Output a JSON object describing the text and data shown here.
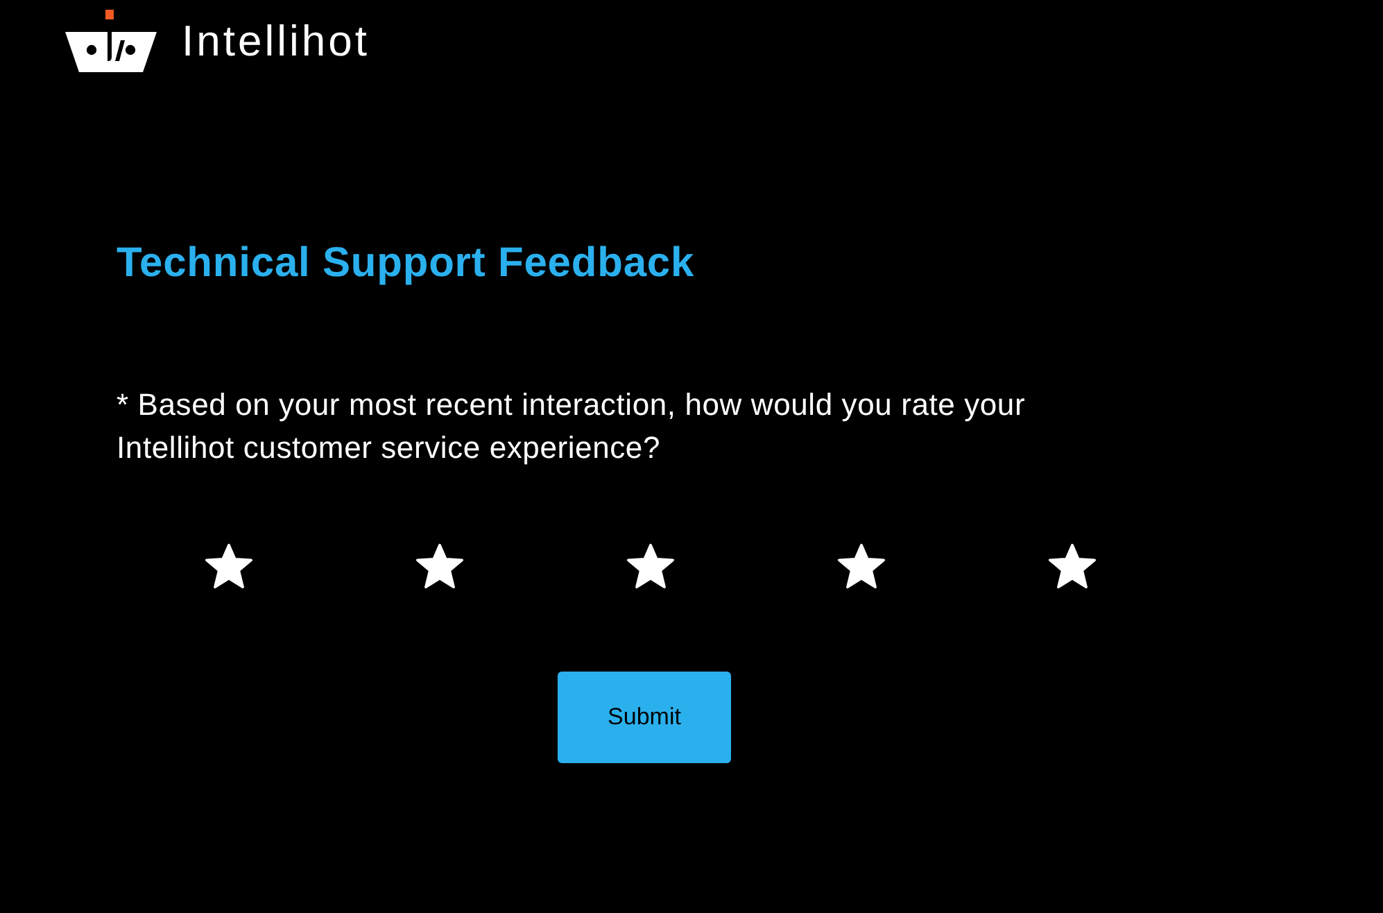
{
  "header": {
    "brand": "Intellihot"
  },
  "form": {
    "title": "Technical Support Feedback",
    "question": "* Based on your most recent interaction, how would you rate your Intellihot customer service experience?",
    "rating": {
      "stars": 5
    },
    "submit_button": {
      "label": "Submit"
    }
  }
}
